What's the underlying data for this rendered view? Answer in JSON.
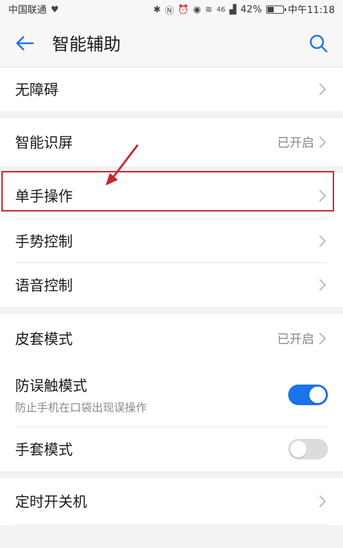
{
  "status_bar": {
    "carrier": "中国联通",
    "network": "46",
    "battery": "42%",
    "battery_level": 0.42,
    "time": "中午11:18"
  },
  "header": {
    "title": "智能辅助"
  },
  "items": {
    "accessibility": {
      "label": "无障碍"
    },
    "screen_recognition": {
      "label": "智能识屏",
      "value": "已开启"
    },
    "one_hand": {
      "label": "单手操作"
    },
    "gesture": {
      "label": "手势控制"
    },
    "voice": {
      "label": "语音控制"
    },
    "cover_mode": {
      "label": "皮套模式",
      "value": "已开启"
    },
    "anti_mistouch": {
      "label": "防误触模式",
      "sub": "防止手机在口袋出现误操作",
      "enabled": true
    },
    "glove_mode": {
      "label": "手套模式",
      "enabled": false
    },
    "scheduled_power": {
      "label": "定时开关机"
    }
  },
  "colors": {
    "accent": "#1a73e8",
    "annotation": "#c8262d"
  }
}
